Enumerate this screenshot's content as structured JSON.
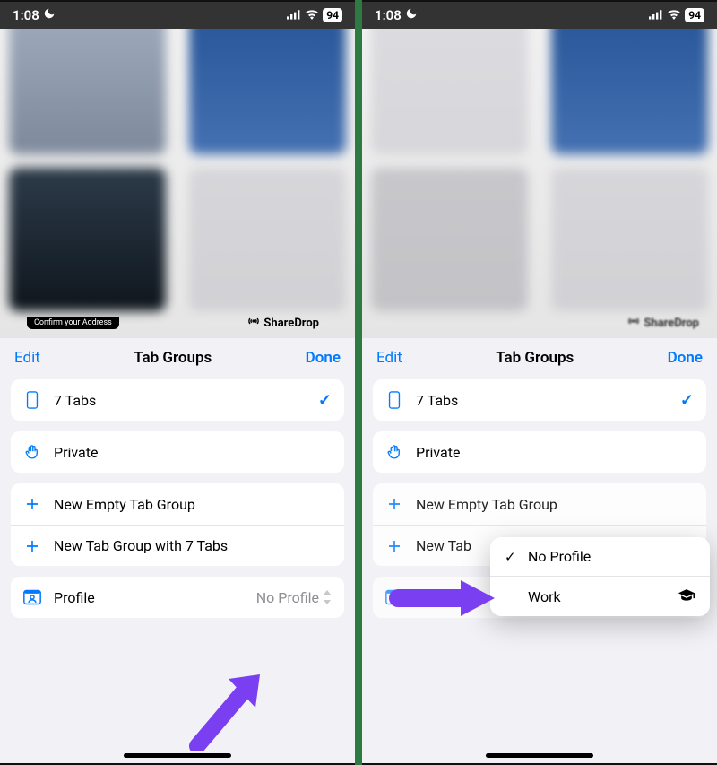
{
  "status": {
    "time": "1:08",
    "battery": "94"
  },
  "background": {
    "address_label": "Confirm your Address",
    "sharedrop_label": "ShareDrop"
  },
  "sheet": {
    "edit": "Edit",
    "title": "Tab Groups",
    "done": "Done",
    "tabs_row": "7 Tabs",
    "private_row": "Private",
    "new_empty": "New Empty Tab Group",
    "new_with_tabs": "New Tab Group with 7 Tabs",
    "new_tab_truncated": "New Tab",
    "profile_label": "Profile",
    "profile_value": "No Profile"
  },
  "popup": {
    "no_profile": "No Profile",
    "work": "Work"
  }
}
